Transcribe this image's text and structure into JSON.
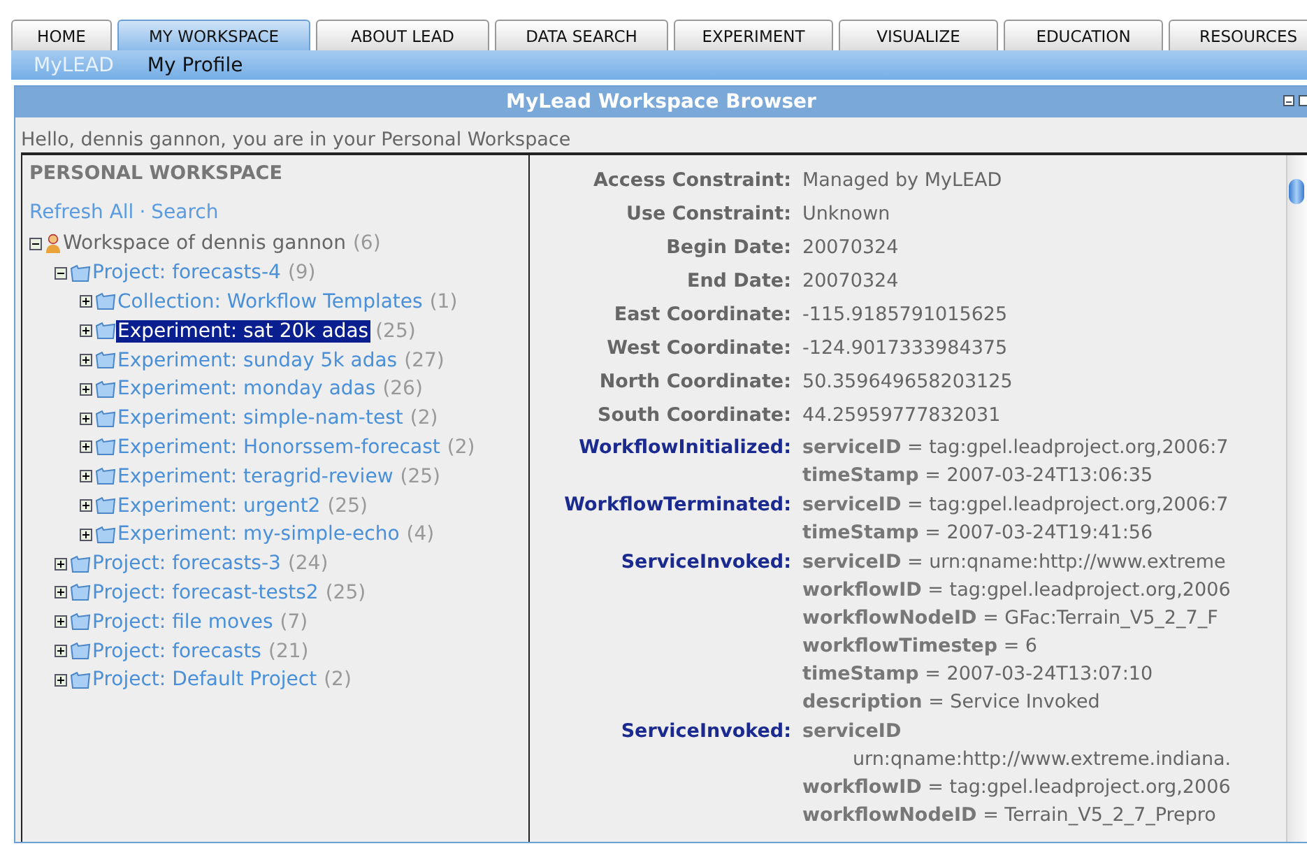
{
  "tabs": [
    {
      "label": "HOME",
      "selected": false
    },
    {
      "label": "MY WORKSPACE",
      "selected": true
    },
    {
      "label": "ABOUT LEAD",
      "selected": false
    },
    {
      "label": "DATA SEARCH",
      "selected": false
    },
    {
      "label": "EXPERIMENT",
      "selected": false
    },
    {
      "label": "VISUALIZE",
      "selected": false
    },
    {
      "label": "EDUCATION",
      "selected": false
    },
    {
      "label": "RESOURCES",
      "selected": false
    }
  ],
  "subnav": [
    {
      "label": "MyLEAD",
      "selected": true
    },
    {
      "label": "My Profile",
      "selected": false
    }
  ],
  "window": {
    "title": "MyLead Workspace Browser",
    "greeting": "Hello, dennis gannon, you are in your Personal Workspace"
  },
  "sidebar": {
    "heading": "PERSONAL WORKSPACE",
    "links": [
      "Refresh All",
      "Search"
    ],
    "separator": "·",
    "tree": [
      {
        "kind": "user",
        "label": "Workspace of dennis gannon",
        "count": "(6)",
        "expanded": true,
        "selected": false,
        "children": [
          {
            "kind": "folder",
            "label": "Project: forecasts-4",
            "count": "(9)",
            "expanded": true,
            "selected": false,
            "children": [
              {
                "kind": "folder",
                "label": "Collection: Workflow Templates",
                "count": "(1)",
                "expanded": false,
                "selected": false
              },
              {
                "kind": "folder",
                "label": "Experiment: sat 20k adas",
                "count": "(25)",
                "expanded": false,
                "selected": true
              },
              {
                "kind": "folder",
                "label": "Experiment: sunday 5k adas",
                "count": "(27)",
                "expanded": false,
                "selected": false
              },
              {
                "kind": "folder",
                "label": "Experiment: monday adas",
                "count": "(26)",
                "expanded": false,
                "selected": false
              },
              {
                "kind": "folder",
                "label": "Experiment: simple-nam-test",
                "count": "(2)",
                "expanded": false,
                "selected": false
              },
              {
                "kind": "folder",
                "label": "Experiment: Honorssem-forecast",
                "count": "(2)",
                "expanded": false,
                "selected": false
              },
              {
                "kind": "folder",
                "label": "Experiment: teragrid-review",
                "count": "(25)",
                "expanded": false,
                "selected": false
              },
              {
                "kind": "folder",
                "label": "Experiment: urgent2",
                "count": "(25)",
                "expanded": false,
                "selected": false
              },
              {
                "kind": "folder",
                "label": "Experiment: my-simple-echo",
                "count": "(4)",
                "expanded": false,
                "selected": false
              }
            ]
          },
          {
            "kind": "folder",
            "label": "Project: forecasts-3",
            "count": "(24)",
            "expanded": false,
            "selected": false
          },
          {
            "kind": "folder",
            "label": "Project: forecast-tests2",
            "count": "(25)",
            "expanded": false,
            "selected": false
          },
          {
            "kind": "folder",
            "label": "Project: file moves",
            "count": "(7)",
            "expanded": false,
            "selected": false
          },
          {
            "kind": "folder",
            "label": "Project: forecasts",
            "count": "(21)",
            "expanded": false,
            "selected": false
          },
          {
            "kind": "folder",
            "label": "Project: Default Project",
            "count": "(2)",
            "expanded": false,
            "selected": false
          }
        ]
      }
    ]
  },
  "details": [
    {
      "label": "Access Constraint:",
      "value": "Managed by MyLEAD"
    },
    {
      "label": "Use Constraint:",
      "value": "Unknown"
    },
    {
      "label": "Begin Date:",
      "value": "20070324"
    },
    {
      "label": "End Date:",
      "value": "20070324"
    },
    {
      "label": "East Coordinate:",
      "value": "-115.9185791015625"
    },
    {
      "label": "West Coordinate:",
      "value": "-124.9017333984375"
    },
    {
      "label": "North Coordinate:",
      "value": "50.359649658203125"
    },
    {
      "label": "South Coordinate:",
      "value": "44.25959777832031"
    }
  ],
  "events": [
    {
      "label": "WorkflowInitialized:",
      "fields": [
        {
          "key": "serviceID",
          "value": "= tag:gpel.leadproject.org,2006:7"
        },
        {
          "key": "timeStamp",
          "value": "= 2007-03-24T13:06:35"
        }
      ]
    },
    {
      "label": "WorkflowTerminated:",
      "fields": [
        {
          "key": "serviceID",
          "value": "= tag:gpel.leadproject.org,2006:7"
        },
        {
          "key": "timeStamp",
          "value": "= 2007-03-24T19:41:56"
        }
      ]
    },
    {
      "label": "ServiceInvoked:",
      "fields": [
        {
          "key": "serviceID",
          "value": "= urn:qname:http://www.extreme"
        },
        {
          "key": "workflowID",
          "value": "= tag:gpel.leadproject.org,2006"
        },
        {
          "key": "workflowNodeID",
          "value": "= GFac:Terrain_V5_2_7_F"
        },
        {
          "key": "workflowTimestep",
          "value": "= 6"
        },
        {
          "key": "timeStamp",
          "value": "= 2007-03-24T13:07:10"
        },
        {
          "key": "description",
          "value": "= Service Invoked"
        }
      ]
    },
    {
      "label": "ServiceInvoked:",
      "fields": [
        {
          "key": "serviceID",
          "value": "urn:qname:http://www.extreme.indiana.",
          "wrapped": true
        },
        {
          "key": "workflowID",
          "value": "= tag:gpel.leadproject.org,2006"
        },
        {
          "key": "workflowNodeID",
          "value": "= Terrain_V5_2_7_Prepro"
        }
      ]
    }
  ]
}
